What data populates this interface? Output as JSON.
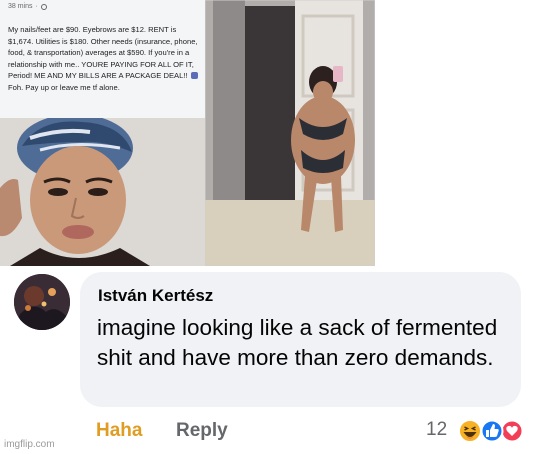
{
  "post": {
    "timestamp": "38 mins",
    "body": "My nails/feet are $90. Eyebrows are $12. RENT is $1,674. Utilities is $180. Other needs (insurance, phone, food, & transportation) averages at $590. If you're in a relationship with me.. YOURE PAYING FOR ALL OF IT, Period! ME AND MY BILLS ARE A PACKAGE DEAL!!",
    "body_tail": "Foh. Pay up or leave me tf alone."
  },
  "comment": {
    "author": "István Kertész",
    "text": "imagine looking like a sack of fermented shit and have more than zero demands.",
    "haha_label": "Haha",
    "reply_label": "Reply",
    "reaction_count": "12",
    "reactions": [
      "haha-icon",
      "like-icon",
      "love-icon"
    ]
  },
  "watermark": "imgflip.com",
  "colors": {
    "haha": "#e09d23",
    "bubble": "#f0f2f5",
    "muted": "#65676b",
    "like": "#1877f2",
    "love": "#f33e58"
  }
}
